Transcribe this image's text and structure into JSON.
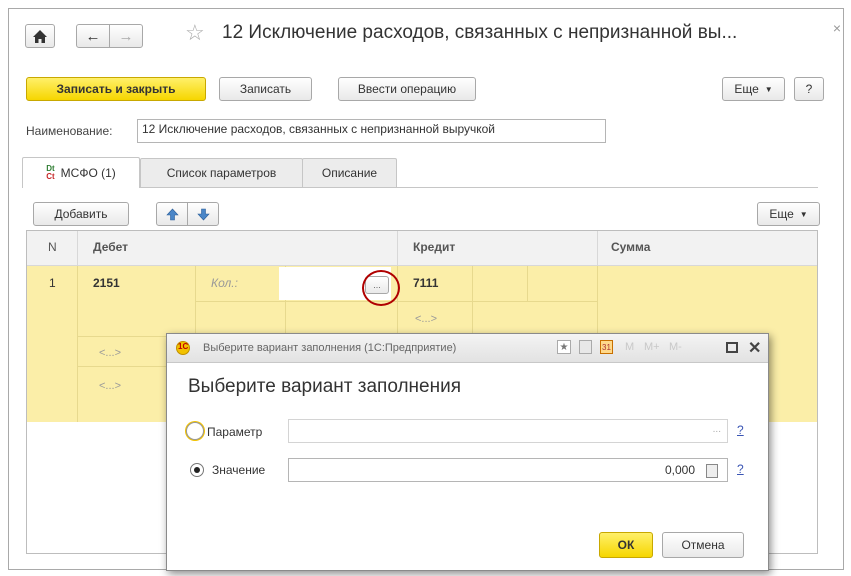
{
  "window": {
    "title": "12 Исключение расходов, связанных с непризнанной вы...",
    "close_glyph": "×"
  },
  "nav": {
    "home_icon": "home-icon",
    "back_glyph": "←",
    "forward_glyph": "→",
    "star_glyph": "☆"
  },
  "toolbar": {
    "save_close_label": "Записать и закрыть",
    "save_label": "Записать",
    "enter_op_label": "Ввести операцию",
    "more_label": "Еще",
    "help_label": "?"
  },
  "form": {
    "name_label": "Наименование:",
    "name_value": "12 Исключение расходов, связанных с непризнанной выручкой"
  },
  "tabs": [
    {
      "label": "МСФО (1)",
      "icon": "dt-ct-icon"
    },
    {
      "label": "Список параметров"
    },
    {
      "label": "Описание"
    }
  ],
  "table_toolbar": {
    "add_label": "Добавить",
    "more_label": "Еще"
  },
  "table": {
    "columns": [
      "N",
      "Дебет",
      "Кредит",
      "Сумма"
    ],
    "row": {
      "n": "1",
      "debit": "2151",
      "qty_label": "Кол.:",
      "ellipsis": "...",
      "credit": "7111",
      "placeholder": "<...>"
    }
  },
  "dialog": {
    "title": "Выберите вариант заполнения (1С:Предприятие)",
    "heading": "Выберите вариант заполнения",
    "title_buttons": [
      "M",
      "M+",
      "M-"
    ],
    "param_label": "Параметр",
    "value_label": "Значение",
    "value": "0,000",
    "help": "?",
    "ok_label": "ОК",
    "cancel_label": "Отмена"
  },
  "colors": {
    "accent": "#f6d600",
    "row": "#fbeea8",
    "highlight_circle": "#b00000"
  }
}
